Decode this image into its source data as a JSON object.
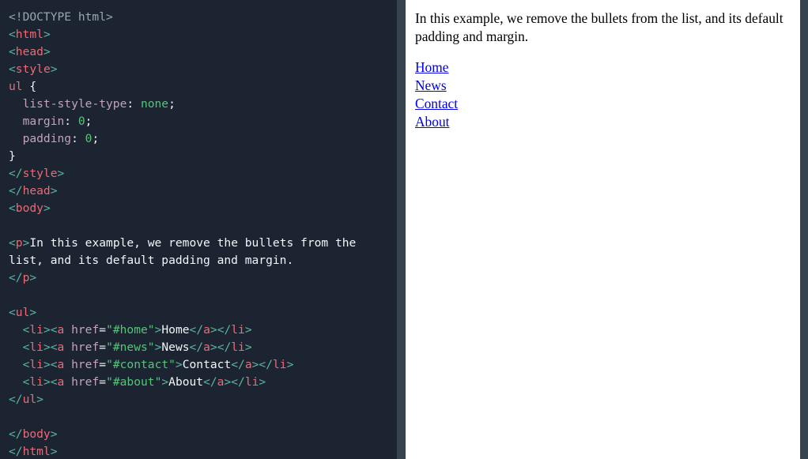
{
  "layout": {
    "code_pane_bg": "#1b2430",
    "scrollbar_color": "#37434f",
    "preview_bg": "#ffffff",
    "link_color": "#0000ee"
  },
  "code": {
    "language": "html",
    "lines": [
      {
        "tokens": [
          {
            "t": "<!DOCTYPE html>",
            "c": "doctype"
          }
        ]
      },
      {
        "tokens": [
          {
            "t": "<",
            "c": "punc"
          },
          {
            "t": "html",
            "c": "tag"
          },
          {
            "t": ">",
            "c": "punc"
          }
        ]
      },
      {
        "tokens": [
          {
            "t": "<",
            "c": "punc"
          },
          {
            "t": "head",
            "c": "tag"
          },
          {
            "t": ">",
            "c": "punc"
          }
        ]
      },
      {
        "tokens": [
          {
            "t": "<",
            "c": "punc"
          },
          {
            "t": "style",
            "c": "tag"
          },
          {
            "t": ">",
            "c": "punc"
          }
        ]
      },
      {
        "tokens": [
          {
            "t": "ul",
            "c": "sel"
          },
          {
            "t": " {",
            "c": "text"
          }
        ]
      },
      {
        "tokens": [
          {
            "t": "  list-style-type",
            "c": "attr"
          },
          {
            "t": ": ",
            "c": "text"
          },
          {
            "t": "none",
            "c": "val"
          },
          {
            "t": ";",
            "c": "text"
          }
        ]
      },
      {
        "tokens": [
          {
            "t": "  margin",
            "c": "attr"
          },
          {
            "t": ": ",
            "c": "text"
          },
          {
            "t": "0",
            "c": "val"
          },
          {
            "t": ";",
            "c": "text"
          }
        ]
      },
      {
        "tokens": [
          {
            "t": "  padding",
            "c": "attr"
          },
          {
            "t": ": ",
            "c": "text"
          },
          {
            "t": "0",
            "c": "val"
          },
          {
            "t": ";",
            "c": "text"
          }
        ]
      },
      {
        "tokens": [
          {
            "t": "}",
            "c": "text"
          }
        ]
      },
      {
        "tokens": [
          {
            "t": "</",
            "c": "punc"
          },
          {
            "t": "style",
            "c": "tag"
          },
          {
            "t": ">",
            "c": "punc"
          }
        ]
      },
      {
        "tokens": [
          {
            "t": "</",
            "c": "punc"
          },
          {
            "t": "head",
            "c": "tag"
          },
          {
            "t": ">",
            "c": "punc"
          }
        ]
      },
      {
        "tokens": [
          {
            "t": "<",
            "c": "punc"
          },
          {
            "t": "body",
            "c": "tag"
          },
          {
            "t": ">",
            "c": "punc"
          }
        ]
      },
      {
        "tokens": []
      },
      {
        "tokens": [
          {
            "t": "<",
            "c": "punc"
          },
          {
            "t": "p",
            "c": "tag"
          },
          {
            "t": ">",
            "c": "punc"
          },
          {
            "t": "In this example, we remove the bullets from the list, and its default padding and margin.",
            "c": "text"
          }
        ]
      },
      {
        "tokens": [
          {
            "t": "</",
            "c": "punc"
          },
          {
            "t": "p",
            "c": "tag"
          },
          {
            "t": ">",
            "c": "punc"
          }
        ]
      },
      {
        "tokens": []
      },
      {
        "tokens": [
          {
            "t": "<",
            "c": "punc"
          },
          {
            "t": "ul",
            "c": "tag"
          },
          {
            "t": ">",
            "c": "punc"
          }
        ]
      },
      {
        "tokens": [
          {
            "t": "  <",
            "c": "punc"
          },
          {
            "t": "li",
            "c": "tag"
          },
          {
            "t": "><",
            "c": "punc"
          },
          {
            "t": "a ",
            "c": "tag"
          },
          {
            "t": "href",
            "c": "attr"
          },
          {
            "t": "=",
            "c": "text"
          },
          {
            "t": "\"#home\"",
            "c": "str"
          },
          {
            "t": ">",
            "c": "punc"
          },
          {
            "t": "Home",
            "c": "text"
          },
          {
            "t": "</",
            "c": "punc"
          },
          {
            "t": "a",
            "c": "tag"
          },
          {
            "t": "></",
            "c": "punc"
          },
          {
            "t": "li",
            "c": "tag"
          },
          {
            "t": ">",
            "c": "punc"
          }
        ]
      },
      {
        "tokens": [
          {
            "t": "  <",
            "c": "punc"
          },
          {
            "t": "li",
            "c": "tag"
          },
          {
            "t": "><",
            "c": "punc"
          },
          {
            "t": "a ",
            "c": "tag"
          },
          {
            "t": "href",
            "c": "attr"
          },
          {
            "t": "=",
            "c": "text"
          },
          {
            "t": "\"#news\"",
            "c": "str"
          },
          {
            "t": ">",
            "c": "punc"
          },
          {
            "t": "News",
            "c": "text"
          },
          {
            "t": "</",
            "c": "punc"
          },
          {
            "t": "a",
            "c": "tag"
          },
          {
            "t": "></",
            "c": "punc"
          },
          {
            "t": "li",
            "c": "tag"
          },
          {
            "t": ">",
            "c": "punc"
          }
        ]
      },
      {
        "tokens": [
          {
            "t": "  <",
            "c": "punc"
          },
          {
            "t": "li",
            "c": "tag"
          },
          {
            "t": "><",
            "c": "punc"
          },
          {
            "t": "a ",
            "c": "tag"
          },
          {
            "t": "href",
            "c": "attr"
          },
          {
            "t": "=",
            "c": "text"
          },
          {
            "t": "\"#contact\"",
            "c": "str"
          },
          {
            "t": ">",
            "c": "punc"
          },
          {
            "t": "Contact",
            "c": "text"
          },
          {
            "t": "</",
            "c": "punc"
          },
          {
            "t": "a",
            "c": "tag"
          },
          {
            "t": "></",
            "c": "punc"
          },
          {
            "t": "li",
            "c": "tag"
          },
          {
            "t": ">",
            "c": "punc"
          }
        ]
      },
      {
        "tokens": [
          {
            "t": "  <",
            "c": "punc"
          },
          {
            "t": "li",
            "c": "tag"
          },
          {
            "t": "><",
            "c": "punc"
          },
          {
            "t": "a ",
            "c": "tag"
          },
          {
            "t": "href",
            "c": "attr"
          },
          {
            "t": "=",
            "c": "text"
          },
          {
            "t": "\"#about\"",
            "c": "str"
          },
          {
            "t": ">",
            "c": "punc"
          },
          {
            "t": "About",
            "c": "text"
          },
          {
            "t": "</",
            "c": "punc"
          },
          {
            "t": "a",
            "c": "tag"
          },
          {
            "t": "></",
            "c": "punc"
          },
          {
            "t": "li",
            "c": "tag"
          },
          {
            "t": ">",
            "c": "punc"
          }
        ]
      },
      {
        "tokens": [
          {
            "t": "</",
            "c": "punc"
          },
          {
            "t": "ul",
            "c": "tag"
          },
          {
            "t": ">",
            "c": "punc"
          }
        ]
      },
      {
        "tokens": []
      },
      {
        "tokens": [
          {
            "t": "</",
            "c": "punc"
          },
          {
            "t": "body",
            "c": "tag"
          },
          {
            "t": ">",
            "c": "punc"
          }
        ]
      },
      {
        "tokens": [
          {
            "t": "</",
            "c": "punc"
          },
          {
            "t": "html",
            "c": "tag"
          },
          {
            "t": ">",
            "c": "punc"
          }
        ]
      }
    ]
  },
  "preview": {
    "paragraph": "In this example, we remove the bullets from the list, and its default padding and margin.",
    "links": [
      {
        "label": "Home",
        "href": "#home"
      },
      {
        "label": "News",
        "href": "#news"
      },
      {
        "label": "Contact",
        "href": "#contact"
      },
      {
        "label": "About",
        "href": "#about"
      }
    ]
  }
}
